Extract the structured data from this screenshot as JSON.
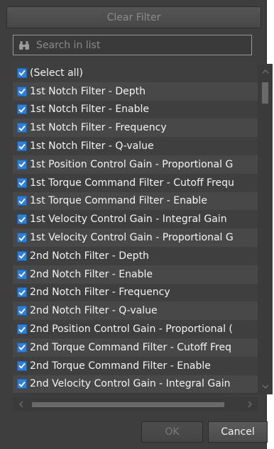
{
  "clear_filter_label": "Clear Filter",
  "search": {
    "placeholder": "Search in list"
  },
  "list": {
    "items": [
      "(Select all)",
      "1st Notch Filter - Depth",
      "1st Notch Filter - Enable",
      "1st Notch Filter - Frequency",
      "1st Notch Filter - Q-value",
      "1st Position Control Gain - Proportional G",
      "1st Torque Command Filter - Cutoff Frequ",
      "1st Torque Command Filter - Enable",
      "1st Velocity Control Gain - Integral Gain",
      "1st Velocity Control Gain - Proportional G",
      "2nd Notch Filter - Depth",
      "2nd Notch Filter - Enable",
      "2nd Notch Filter - Frequency",
      "2nd Notch Filter - Q-value",
      "2nd Position Control Gain - Proportional (",
      "2nd Torque Command Filter - Cutoff Freq",
      "2nd Torque Command Filter - Enable",
      "2nd Velocity Control Gain - Integral Gain"
    ]
  },
  "buttons": {
    "ok_label": "OK",
    "cancel_label": "Cancel"
  },
  "colors": {
    "panel_bg": "#3e3e3e",
    "checkbox_checked": "#2f7fd6",
    "row_odd": "#3f3f3f",
    "row_even": "#484848"
  },
  "icons": {
    "search": "binoculars-icon",
    "checkbox": "checkmark-icon"
  }
}
